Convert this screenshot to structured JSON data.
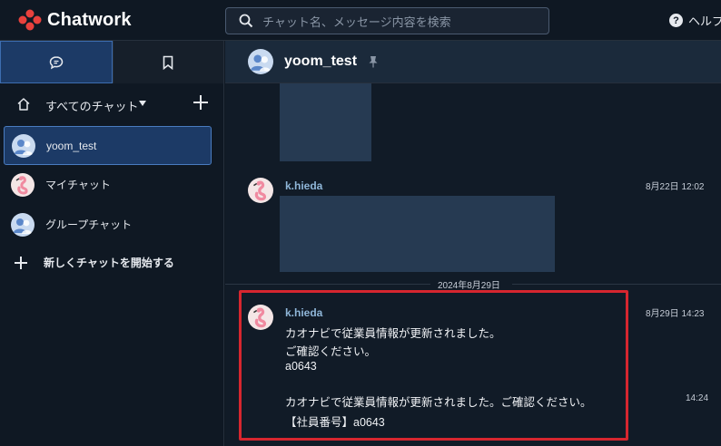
{
  "app": {
    "name": "Chatwork",
    "colors": {
      "accent": "#1c3a66",
      "highlight": "#d6262f",
      "brand_red": "#e8413d"
    }
  },
  "search": {
    "placeholder": "チャット名、メッセージ内容を検索",
    "icon": "search-icon"
  },
  "help": {
    "label": "ヘルプ",
    "icon": "question-icon"
  },
  "sidebar": {
    "tabs": [
      {
        "icon": "chat-bubble-icon",
        "active": true
      },
      {
        "icon": "bookmark-icon",
        "active": false
      }
    ],
    "filter_label": "すべてのチャット",
    "rooms": [
      {
        "label": "yoom_test",
        "selected": true,
        "avatar": "group-avatar"
      },
      {
        "label": "マイチャット",
        "selected": false,
        "avatar": "flamingo-avatar"
      },
      {
        "label": "グループチャット",
        "selected": false,
        "avatar": "group-avatar"
      }
    ],
    "new_chat_label": "新しくチャットを開始する"
  },
  "chat": {
    "title": "yoom_test",
    "messages": [
      {
        "sender": "k.hieda",
        "time": "8月22日 12:02"
      },
      {
        "date_separator": "2024年8月29日"
      },
      {
        "sender": "k.hieda",
        "time": "8月29日 14:23",
        "lines": [
          "カオナビで従業員情報が更新されました。",
          "ご確認ください。",
          "a0643"
        ],
        "followup_time": "14:24",
        "followup_lines": [
          "カオナビで従業員情報が更新されました。ご確認ください。",
          "【社員番号】a0643"
        ]
      }
    ]
  }
}
